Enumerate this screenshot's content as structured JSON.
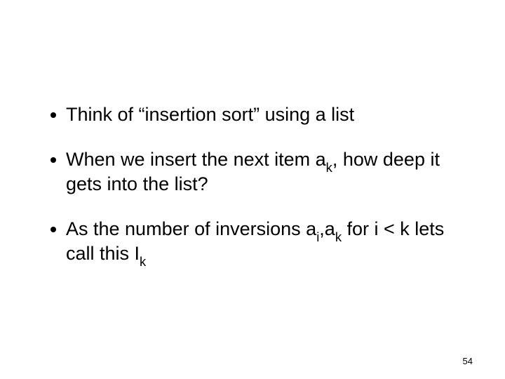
{
  "bullets": [
    {
      "pre": "Think of “insertion sort” using a list",
      "sub1": "",
      "mid": "",
      "sub2": "",
      "post": ""
    },
    {
      "pre": "When we insert the next item a",
      "sub1": "k",
      "mid": ", how deep it gets into the list?",
      "sub2": "",
      "post": ""
    },
    {
      "pre": "As the number of inversions a",
      "sub1": "i",
      "mid": ",a",
      "sub2": "k",
      "post": " for i < k lets call this I",
      "sub3": "k",
      "tail": ""
    }
  ],
  "page_number": "54"
}
